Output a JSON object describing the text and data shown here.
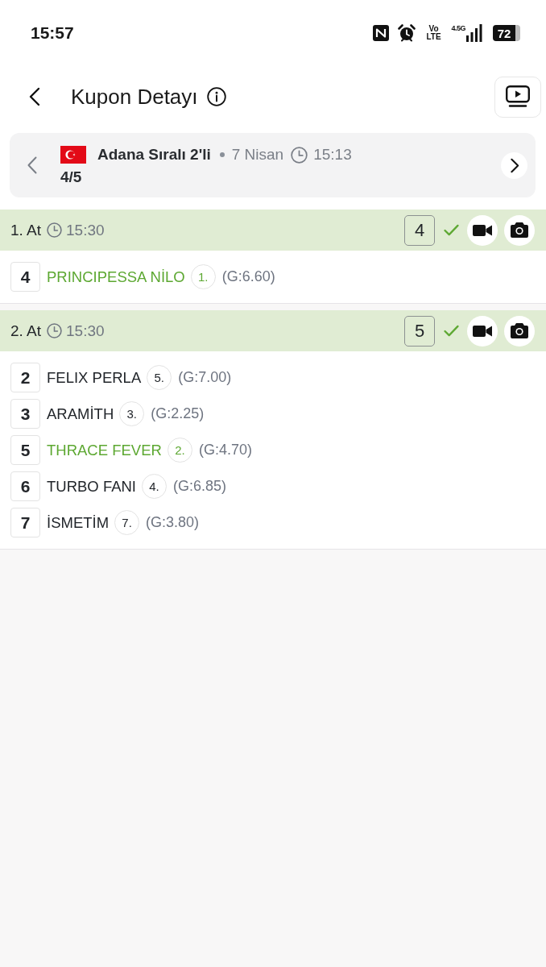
{
  "status_bar": {
    "time": "15:57",
    "volte": "Vo LTE",
    "network_type": "4.5G",
    "battery": "72"
  },
  "header": {
    "title": "Kupon Detayı"
  },
  "race": {
    "name": "Adana Sıralı 2'li",
    "date": "7 Nisan",
    "time": "15:13",
    "position": "4/5"
  },
  "legs": [
    {
      "label": "1. At",
      "time": "15:30",
      "result": "4",
      "correct": true,
      "horses": [
        {
          "number": "4",
          "name": "PRINCIPESSA NİLO",
          "place": "1.",
          "odds": "(G:6.60)",
          "matched": true
        }
      ]
    },
    {
      "label": "2. At",
      "time": "15:30",
      "result": "5",
      "correct": true,
      "horses": [
        {
          "number": "2",
          "name": "FELIX PERLA",
          "place": "5.",
          "odds": "(G:7.00)",
          "matched": false
        },
        {
          "number": "3",
          "name": "ARAMİTH",
          "place": "3.",
          "odds": "(G:2.25)",
          "matched": false
        },
        {
          "number": "5",
          "name": "THRACE FEVER",
          "place": "2.",
          "odds": "(G:4.70)",
          "matched": true
        },
        {
          "number": "6",
          "name": "TURBO FANI",
          "place": "4.",
          "odds": "(G:6.85)",
          "matched": false
        },
        {
          "number": "7",
          "name": "İSMETİM",
          "place": "7.",
          "odds": "(G:3.80)",
          "matched": false
        }
      ]
    }
  ]
}
